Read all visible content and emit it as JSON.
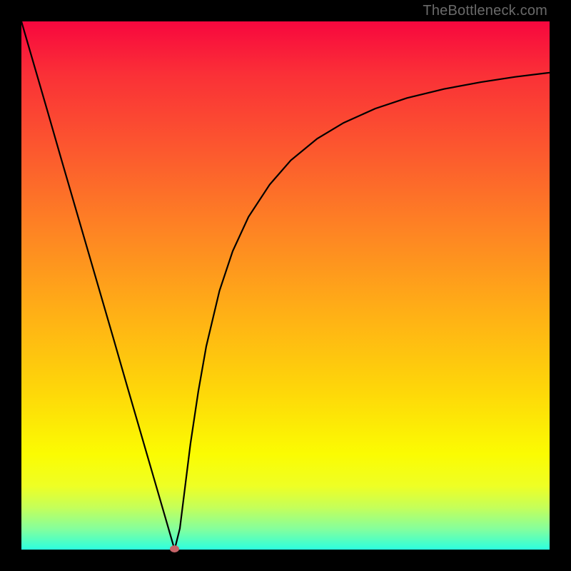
{
  "site_credit": "TheBottleneck.com",
  "colors": {
    "frame": "#000000",
    "curve": "#000000",
    "marker": "#c76469",
    "gradient_stops": [
      "#f8073e",
      "#fa3037",
      "#fc5a2e",
      "#fe8523",
      "#ffaf16",
      "#fed709",
      "#fbfc02",
      "#eeff25",
      "#c5ff59",
      "#86ff9b",
      "#2cffdf"
    ]
  },
  "chart_data": {
    "type": "line",
    "title": "",
    "xlabel": "",
    "ylabel": "",
    "xlim": [
      0,
      1
    ],
    "ylim": [
      0,
      1
    ],
    "x": [
      0.0,
      0.025,
      0.05,
      0.075,
      0.1,
      0.125,
      0.15,
      0.175,
      0.2,
      0.225,
      0.25,
      0.275,
      0.29,
      0.3,
      0.31,
      0.32,
      0.335,
      0.35,
      0.375,
      0.4,
      0.43,
      0.47,
      0.51,
      0.56,
      0.61,
      0.67,
      0.73,
      0.8,
      0.87,
      0.935,
      1.0
    ],
    "y": [
      1.0,
      0.914,
      0.828,
      0.741,
      0.655,
      0.569,
      0.483,
      0.397,
      0.31,
      0.224,
      0.138,
      0.052,
      0.0,
      0.04,
      0.12,
      0.2,
      0.3,
      0.385,
      0.49,
      0.565,
      0.63,
      0.691,
      0.737,
      0.778,
      0.808,
      0.835,
      0.855,
      0.872,
      0.885,
      0.895,
      0.903
    ],
    "marker": {
      "x": 0.29,
      "y": 0.0
    },
    "note": "x and y are normalized to [0,1] on the plot area; y=0 is bottom, y=1 is top"
  }
}
